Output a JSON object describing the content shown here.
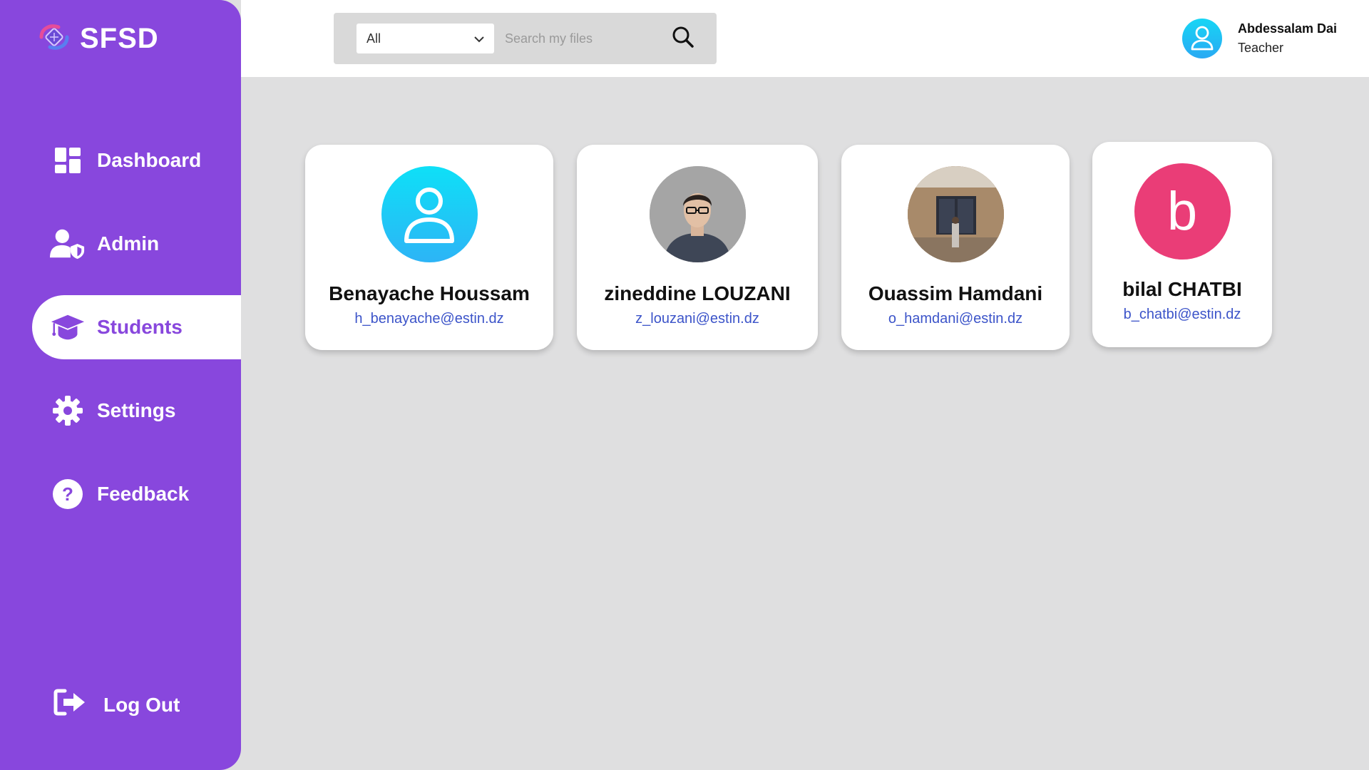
{
  "app": {
    "name": "SFSD"
  },
  "sidebar": {
    "items": [
      {
        "label": "Dashboard",
        "icon": "dashboard-icon"
      },
      {
        "label": "Admin",
        "icon": "admin-user-icon"
      },
      {
        "label": "Students",
        "icon": "graduation-cap-icon",
        "active": true
      },
      {
        "label": "Settings",
        "icon": "gear-icon"
      },
      {
        "label": "Feedback",
        "icon": "question-icon"
      }
    ],
    "logout_label": "Log Out"
  },
  "header": {
    "filter": {
      "selected": "All"
    },
    "search": {
      "placeholder": "Search my files",
      "value": ""
    },
    "user": {
      "name": "Abdessalam Dai",
      "role": "Teacher"
    }
  },
  "students": [
    {
      "name": "Benayache Houssam",
      "email": "h_benayache@estin.dz",
      "avatar": "default-user-icon"
    },
    {
      "name": "zineddine LOUZANI",
      "email": "z_louzani@estin.dz",
      "avatar": "profile-photo"
    },
    {
      "name": "Ouassim Hamdani",
      "email": "o_hamdani@estin.dz",
      "avatar": "profile-photo"
    },
    {
      "name": "bilal CHATBI",
      "email": "b_chatbi@estin.dz",
      "avatar": "letter-avatar",
      "initial": "b"
    }
  ],
  "colors": {
    "sidebar": "#8847dd",
    "background": "#dfdfe0",
    "email_link": "#3c54c9",
    "letter_avatar": "#ea3d77",
    "user_avatar": "#1fc3f4"
  }
}
